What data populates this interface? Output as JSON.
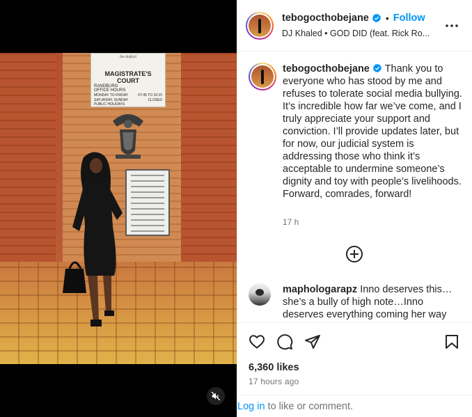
{
  "post": {
    "media": {
      "sign": {
        "dept_line": "the doj&cd",
        "court": "MAGISTRATE'S COURT",
        "place": "RANDBURG",
        "office_hours": "OFFICE HOURS",
        "weekdays": "MONDAY TO FRIDAY",
        "weekday_hours": "07:45 TO 16:15",
        "weekend": "SATURDAY, SUNDAY PUBLIC HOLIDAYS",
        "weekend_status": "CLOSED"
      },
      "mute_icon": "muted-speaker-icon"
    },
    "header": {
      "username": "tebogocthobejane",
      "separator": "•",
      "follow_label": "Follow",
      "audio": "DJ Khaled • GOD DID (feat. Rick Ro...",
      "more_icon": "more-options-icon"
    },
    "caption": {
      "username": "tebogocthobejane",
      "text": "Thank you to everyone who has stood by me and refuses to tolerate social media bullying. It’s incredible how far we’ve come, and I truly appreciate your support and conviction. I’ll provide updates later, but for now, our judicial system is addressing those who think it’s acceptable to undermine someone’s dignity and toy with people’s livelihoods. Forward, comrades, forward!",
      "time": "17 h"
    },
    "load_more_icon": "plus-circle-icon",
    "comments": [
      {
        "username": "maphologarapz",
        "text": "Inno deserves this… she’s a bully of high note…Inno deserves everything coming her way"
      }
    ],
    "actions": {
      "like_icon": "heart-icon",
      "comment_icon": "comment-icon",
      "share_icon": "share-icon",
      "save_icon": "bookmark-icon",
      "likes": "6,360 likes",
      "time_ago": "17 hours ago"
    },
    "login": {
      "link": "Log in",
      "rest": " to like or comment."
    },
    "colors": {
      "accent": "#0095f6",
      "text": "#262626",
      "muted": "#737373",
      "border": "#efefef"
    }
  }
}
